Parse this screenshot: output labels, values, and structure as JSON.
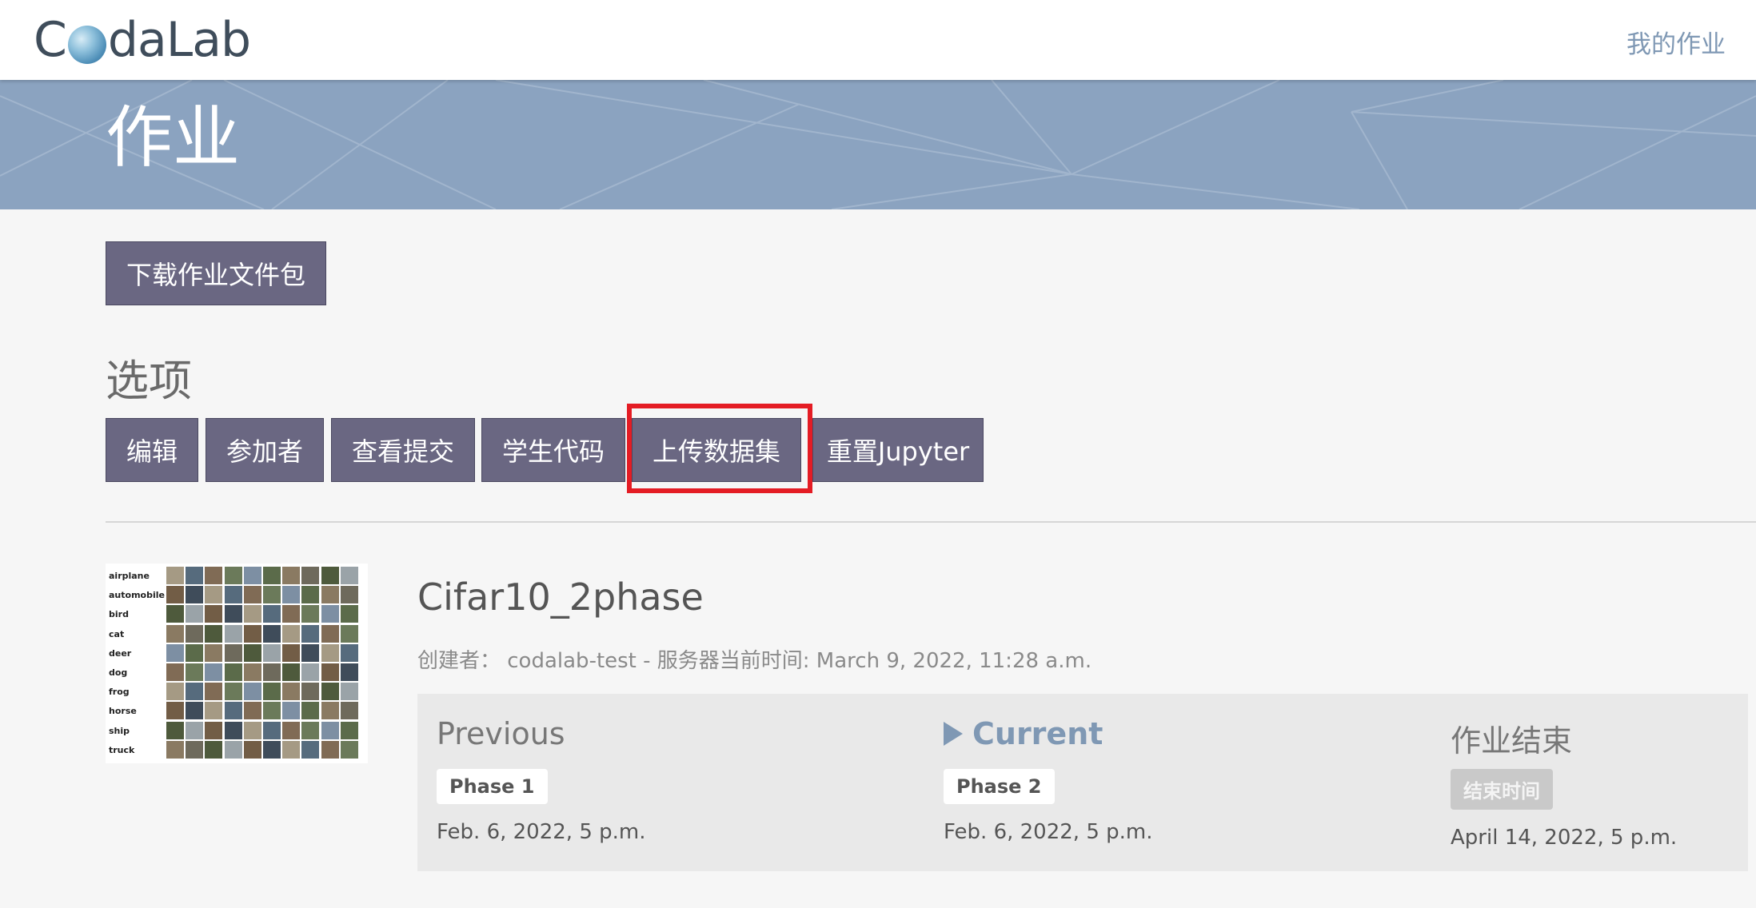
{
  "header": {
    "logo_text_before": "C",
    "logo_text_after": "daLab",
    "my_assignments_link": "我的作业"
  },
  "banner": {
    "title": "作业"
  },
  "download_button": "下载作业文件包",
  "options": {
    "title": "选项",
    "buttons": [
      "编辑",
      "参加者",
      "查看提交",
      "学生代码",
      "上传数据集",
      "重置Jupyter"
    ]
  },
  "thumbnail": {
    "labels": [
      "airplane",
      "automobile",
      "bird",
      "cat",
      "deer",
      "dog",
      "frog",
      "horse",
      "ship",
      "truck"
    ]
  },
  "competition": {
    "title": "Cifar10_2phase",
    "meta": "创建者：  codalab-test - 服务器当前时间: March 9, 2022, 11:28 a.m."
  },
  "phases": [
    {
      "heading": "Previous",
      "badge": "Phase 1",
      "date": "Feb. 6, 2022, 5 p.m."
    },
    {
      "heading": "Current",
      "badge": "Phase 2",
      "date": "Feb. 6, 2022, 5 p.m."
    },
    {
      "heading": "作业结束",
      "badge": "结束时间",
      "date": "April 14, 2022, 5 p.m."
    }
  ],
  "colors": {
    "button_bg": "#6a6782",
    "banner_bg": "#8ba3c0",
    "link": "#7f98b4",
    "highlight": "#e41c24"
  }
}
